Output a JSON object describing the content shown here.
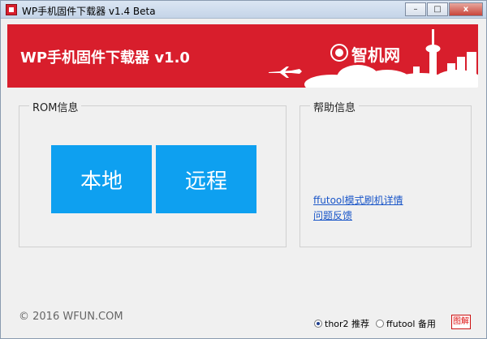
{
  "window": {
    "title": "WP手机固件下载器 v1.4 Beta",
    "controls": {
      "minimize": "–",
      "maximize": "□",
      "close": "x"
    }
  },
  "banner": {
    "title": "WP手机固件下载器 v1.0",
    "logo_text": "智机网",
    "background_color": "#d81e2c"
  },
  "rom": {
    "group_label": "ROM信息",
    "local_button": "本地",
    "remote_button": "远程",
    "tile_color": "#0ea0f0"
  },
  "help": {
    "group_label": "帮助信息",
    "links": [
      "ffutool模式刷机详情",
      "问题反馈"
    ]
  },
  "footer": {
    "copyright": "© 2016 WFUN.COM",
    "radio_options": [
      {
        "label": "thor2 推荐",
        "checked": true
      },
      {
        "label": "ffutool 备用",
        "checked": false
      }
    ],
    "screenshot_button": "图解"
  }
}
